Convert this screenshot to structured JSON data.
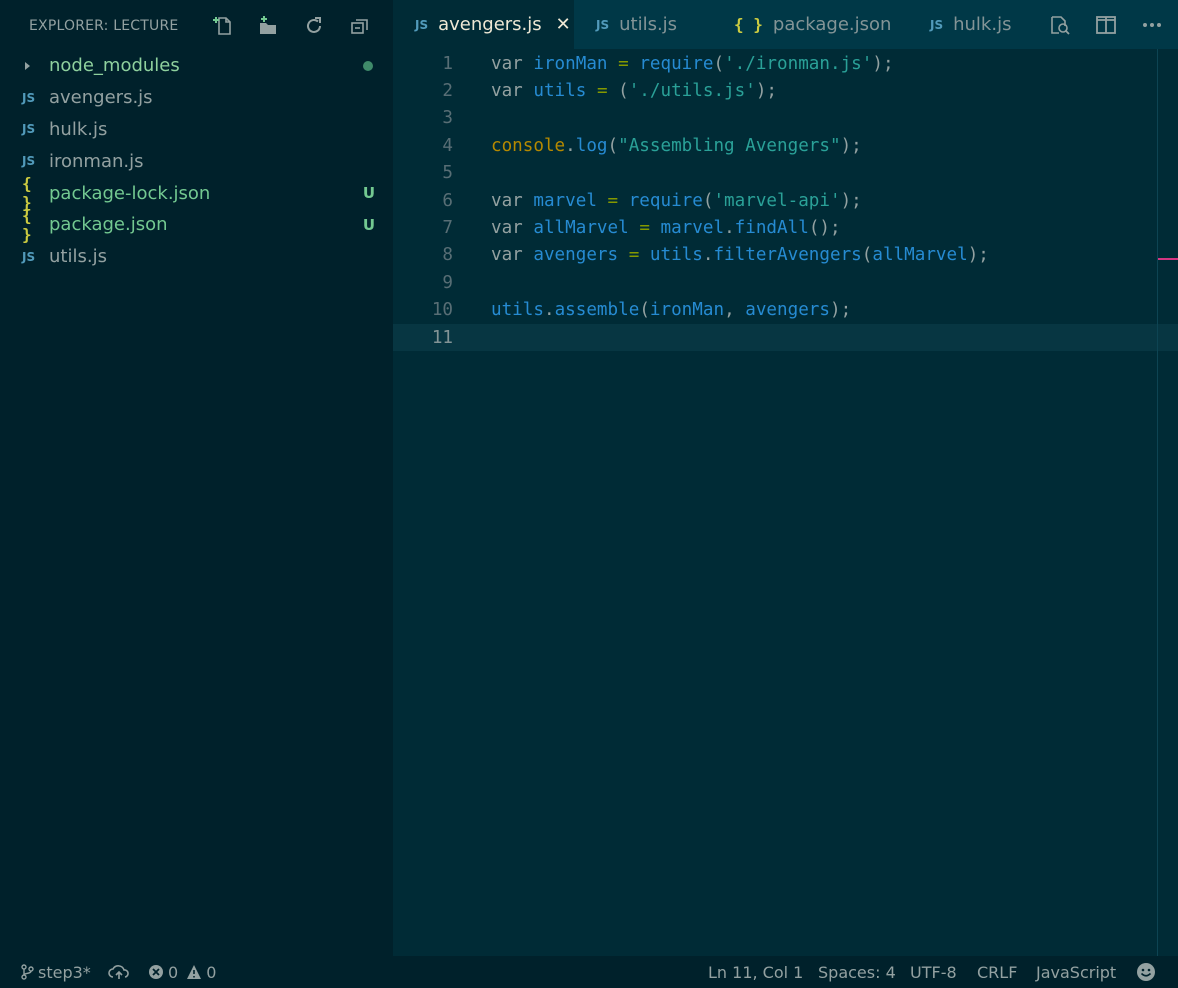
{
  "sidebar": {
    "title": "EXPLORER: LECTURE",
    "actions": [
      "new-file-icon",
      "new-folder-icon",
      "refresh-icon",
      "collapse-all-icon"
    ],
    "files": [
      {
        "name": "node_modules",
        "type": "folder",
        "status": "dot"
      },
      {
        "name": "avengers.js",
        "type": "js",
        "status": ""
      },
      {
        "name": "hulk.js",
        "type": "js",
        "status": ""
      },
      {
        "name": "ironman.js",
        "type": "js",
        "status": ""
      },
      {
        "name": "package-lock.json",
        "type": "json",
        "status": "U"
      },
      {
        "name": "package.json",
        "type": "json",
        "status": "U"
      },
      {
        "name": "utils.js",
        "type": "js",
        "status": ""
      }
    ]
  },
  "tabs": [
    {
      "label": "avengers.js",
      "icon": "JS",
      "active": true
    },
    {
      "label": "utils.js",
      "icon": "JS",
      "active": false
    },
    {
      "label": "package.json",
      "icon": "{}",
      "active": false
    },
    {
      "label": "hulk.js",
      "icon": "JS",
      "active": false
    }
  ],
  "icons": {
    "js": "JS",
    "json": "{ }",
    "close": "✕"
  },
  "editor": {
    "lines": [
      "var ironMan = require('./ironman.js');",
      "var utils = ('./utils.js');",
      "",
      "console.log(\"Assembling Avengers\");",
      "",
      "var marvel = require('marvel-api');",
      "var allMarvel = marvel.findAll();",
      "var avengers = utils.filterAvengers(allMarvel);",
      "",
      "utils.assemble(ironMan, avengers);",
      ""
    ],
    "line_numbers": [
      "1",
      "2",
      "3",
      "4",
      "5",
      "6",
      "7",
      "8",
      "9",
      "10",
      "11"
    ],
    "current_line": 11
  },
  "statusbar": {
    "branch": "step3*",
    "errors": "0",
    "warnings": "0",
    "cursor": "Ln 11, Col 1",
    "spaces": "Spaces: 4",
    "encoding": "UTF-8",
    "eol": "CRLF",
    "language": "JavaScript"
  },
  "colors": {
    "sidebar_bg": "#00212b",
    "editor_bg": "#002b36",
    "tabbar_bg": "#003847",
    "keyword": "#93a1a1",
    "identifier": "#268bd2",
    "operator": "#859900",
    "string": "#2aa198",
    "class": "#b58900",
    "untracked": "#73c991"
  }
}
